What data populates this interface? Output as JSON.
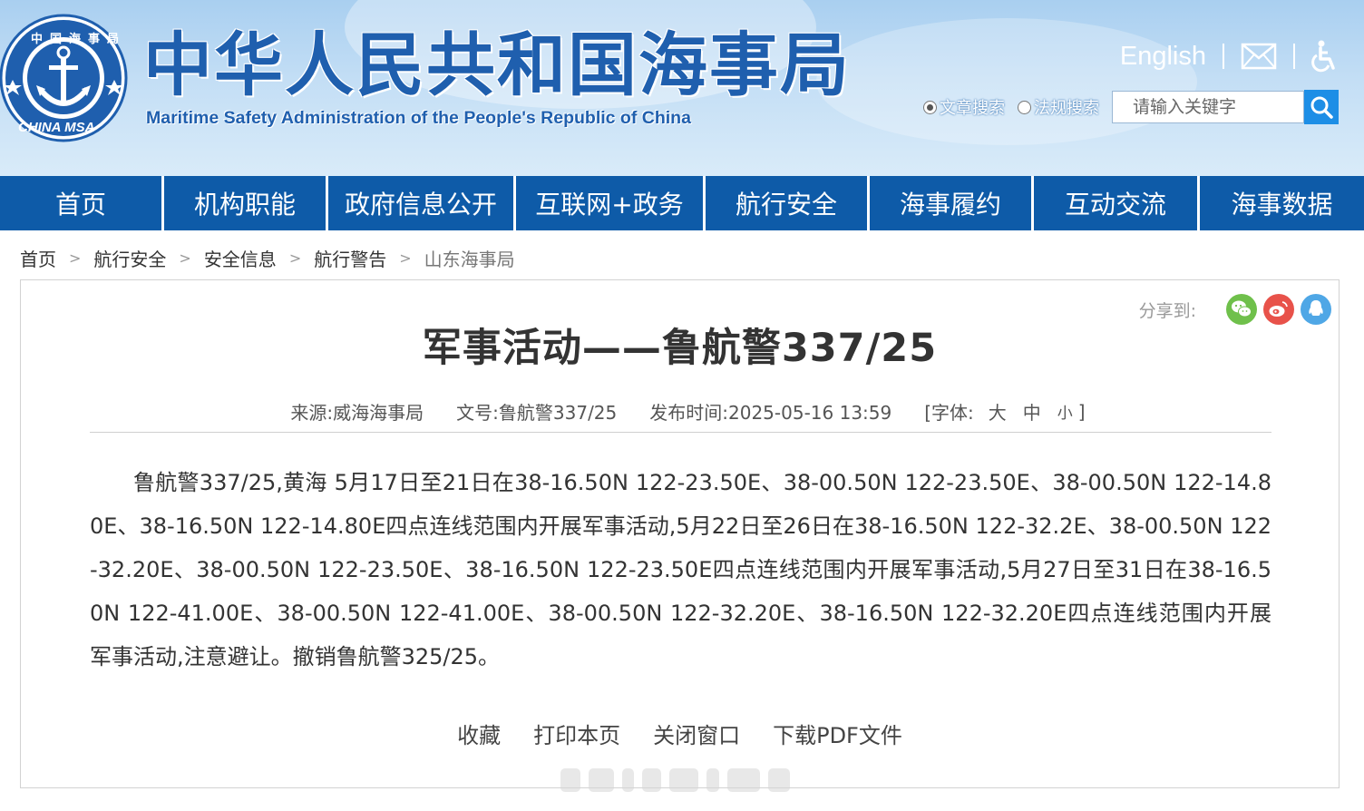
{
  "header": {
    "title": "中华人民共和国海事局",
    "subtitle": "Maritime Safety Administration of the People's Republic of China",
    "logo": {
      "top_text": "中国海事局",
      "bottom_text": "CHINA MSA",
      "icon": "anchor-emblem-icon"
    },
    "lang_link": "English",
    "mail_icon": "mail-icon",
    "accessibility_icon": "accessibility-icon",
    "search": {
      "radio_article": "文章搜索",
      "radio_law": "法规搜索",
      "selected": "文章搜索",
      "placeholder": "请输入关键字",
      "button_icon": "search-icon"
    }
  },
  "nav": {
    "items": [
      "首页",
      "机构职能",
      "政府信息公开",
      "互联网+政务",
      "航行安全",
      "海事履约",
      "互动交流",
      "海事数据"
    ]
  },
  "breadcrumb": [
    "首页",
    "航行安全",
    "安全信息",
    "航行警告",
    "山东海事局"
  ],
  "article": {
    "share_label": "分享到:",
    "share_icons": [
      "wechat-icon",
      "weibo-icon",
      "qq-icon"
    ],
    "title": "军事活动——鲁航警337/25",
    "meta": {
      "source": "来源:威海海事局",
      "doc_no": "文号:鲁航警337/25",
      "published": "发布时间:2025-05-16 13:59",
      "font_label": "[字体:",
      "font_large": "大",
      "font_medium": "中",
      "font_small": "小",
      "font_close": "]"
    },
    "body": "鲁航警337/25,黄海 5月17日至21日在38-16.50N 122-23.50E、38-00.50N 122-23.50E、38-00.50N 122-14.80E、38-16.50N 122-14.80E四点连线范围内开展军事活动,5月22日至26日在38-16.50N 122-32.2E、38-00.50N 122-32.20E、38-00.50N 122-23.50E、38-16.50N 122-23.50E四点连线范围内开展军事活动,5月27日至31日在38-16.50N 122-41.00E、38-00.50N 122-41.00E、38-00.50N 122-32.20E、38-16.50N 122-32.20E四点连线范围内开展军事活动,注意避让。撤销鲁航警325/25。",
    "actions": {
      "favorite": "收藏",
      "print": "打印本页",
      "close": "关闭窗口",
      "download": "下载PDF文件"
    }
  },
  "colors": {
    "nav_bg": "#0e5ba8",
    "title_blue": "#1f5fae",
    "search_btn": "#1d8ee6",
    "wechat": "#6fc04b",
    "weibo": "#e8524a",
    "qq": "#4fa7e6"
  }
}
